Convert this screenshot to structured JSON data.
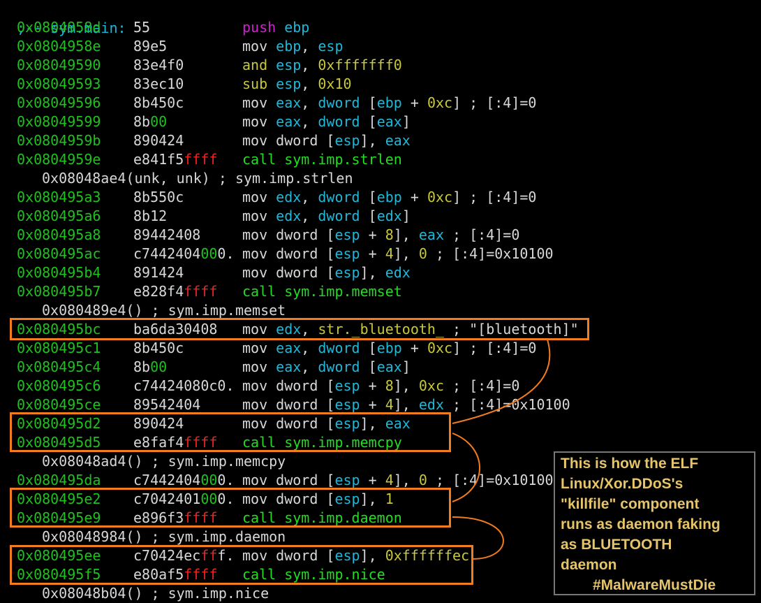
{
  "header": ";-- sym.main:",
  "colors": {
    "address": "#20c020",
    "mnemonic_default": "#d8d8d8",
    "register": "#1fb7d8",
    "immediate": "#c8c83a",
    "push": "#d020d0",
    "call": "#22dd22",
    "ff_bytes": "#ee2020",
    "highlight_box": "#f27c20",
    "note_text": "#e6c46a"
  },
  "lines": [
    {
      "addr": "0x0804958d",
      "bytes": [
        [
          "55",
          "white"
        ]
      ],
      "instr": [
        [
          "push ",
          "magenta"
        ],
        [
          "ebp",
          "cyan"
        ]
      ]
    },
    {
      "addr": "0x0804958e",
      "bytes": [
        [
          "89e5",
          "white"
        ]
      ],
      "instr": [
        [
          "mov ",
          "white"
        ],
        [
          "ebp",
          "cyan"
        ],
        [
          ", ",
          "white"
        ],
        [
          "esp",
          "cyan"
        ]
      ]
    },
    {
      "addr": "0x08049590",
      "bytes": [
        [
          "83e4f0",
          "white"
        ]
      ],
      "instr": [
        [
          "and ",
          "yellow"
        ],
        [
          "esp",
          "cyan"
        ],
        [
          ", ",
          "white"
        ],
        [
          "0xfffffff0",
          "yellow"
        ]
      ]
    },
    {
      "addr": "0x08049593",
      "bytes": [
        [
          "83ec10",
          "white"
        ]
      ],
      "instr": [
        [
          "sub ",
          "yellow"
        ],
        [
          "esp",
          "cyan"
        ],
        [
          ", ",
          "white"
        ],
        [
          "0x10",
          "yellow"
        ]
      ]
    },
    {
      "addr": "0x08049596",
      "bytes": [
        [
          "8b450c",
          "white"
        ]
      ],
      "instr": [
        [
          "mov ",
          "white"
        ],
        [
          "eax",
          "cyan"
        ],
        [
          ", ",
          "white"
        ],
        [
          "dword ",
          "cyan"
        ],
        [
          "[",
          "white"
        ],
        [
          "ebp",
          "cyan"
        ],
        [
          " + ",
          "white"
        ],
        [
          "0xc",
          "yellow"
        ],
        [
          "] ; [:4]=0",
          "white"
        ]
      ]
    },
    {
      "addr": "0x08049599",
      "bytes": [
        [
          "8b",
          "white"
        ],
        [
          "00",
          "green"
        ]
      ],
      "instr": [
        [
          "mov ",
          "white"
        ],
        [
          "eax",
          "cyan"
        ],
        [
          ", ",
          "white"
        ],
        [
          "dword ",
          "cyan"
        ],
        [
          "[",
          "white"
        ],
        [
          "eax",
          "cyan"
        ],
        [
          "]",
          "white"
        ]
      ]
    },
    {
      "addr": "0x0804959b",
      "bytes": [
        [
          "890424",
          "white"
        ]
      ],
      "instr": [
        [
          "mov dword ",
          "white"
        ],
        [
          "[",
          "white"
        ],
        [
          "esp",
          "cyan"
        ],
        [
          "], ",
          "white"
        ],
        [
          "eax",
          "cyan"
        ]
      ]
    },
    {
      "addr": "0x0804959e",
      "bytes": [
        [
          "e841f5",
          "white"
        ],
        [
          "ffff",
          "red"
        ]
      ],
      "instr": [
        [
          "call ",
          "lime"
        ],
        [
          "sym.imp.strlen",
          "lime"
        ]
      ]
    },
    {
      "sub": "0x08048ae4(unk, unk) ; sym.imp.strlen"
    },
    {
      "addr": "0x080495a3",
      "bytes": [
        [
          "8b550c",
          "white"
        ]
      ],
      "instr": [
        [
          "mov ",
          "white"
        ],
        [
          "edx",
          "cyan"
        ],
        [
          ", ",
          "white"
        ],
        [
          "dword ",
          "cyan"
        ],
        [
          "[",
          "white"
        ],
        [
          "ebp",
          "cyan"
        ],
        [
          " + ",
          "white"
        ],
        [
          "0xc",
          "yellow"
        ],
        [
          "] ; [:4]=0",
          "white"
        ]
      ]
    },
    {
      "addr": "0x080495a6",
      "bytes": [
        [
          "8b12",
          "white"
        ]
      ],
      "instr": [
        [
          "mov ",
          "white"
        ],
        [
          "edx",
          "cyan"
        ],
        [
          ", ",
          "white"
        ],
        [
          "dword ",
          "cyan"
        ],
        [
          "[",
          "white"
        ],
        [
          "edx",
          "cyan"
        ],
        [
          "]",
          "white"
        ]
      ]
    },
    {
      "addr": "0x080495a8",
      "bytes": [
        [
          "89442408",
          "white"
        ]
      ],
      "instr": [
        [
          "mov dword ",
          "white"
        ],
        [
          "[",
          "white"
        ],
        [
          "esp",
          "cyan"
        ],
        [
          " + ",
          "white"
        ],
        [
          "8",
          "yellow"
        ],
        [
          "], ",
          "white"
        ],
        [
          "eax",
          "cyan"
        ],
        [
          " ; [:4]=0",
          "white"
        ]
      ]
    },
    {
      "addr": "0x080495ac",
      "bytes": [
        [
          "c7442404",
          "white"
        ],
        [
          "00",
          "green"
        ],
        [
          "0.",
          "white"
        ]
      ],
      "instr": [
        [
          "mov dword ",
          "white"
        ],
        [
          "[",
          "white"
        ],
        [
          "esp",
          "cyan"
        ],
        [
          " + ",
          "white"
        ],
        [
          "4",
          "yellow"
        ],
        [
          "], ",
          "white"
        ],
        [
          "0",
          "yellow"
        ],
        [
          " ; [:4]=0x10100",
          "white"
        ]
      ]
    },
    {
      "addr": "0x080495b4",
      "bytes": [
        [
          "891424",
          "white"
        ]
      ],
      "instr": [
        [
          "mov dword ",
          "white"
        ],
        [
          "[",
          "white"
        ],
        [
          "esp",
          "cyan"
        ],
        [
          "], ",
          "white"
        ],
        [
          "edx",
          "cyan"
        ]
      ]
    },
    {
      "addr": "0x080495b7",
      "bytes": [
        [
          "e828f4",
          "white"
        ],
        [
          "ffff",
          "red"
        ]
      ],
      "instr": [
        [
          "call ",
          "lime"
        ],
        [
          "sym.imp.memset",
          "lime"
        ]
      ]
    },
    {
      "sub": "0x080489e4() ; sym.imp.memset"
    },
    {
      "addr": "0x080495bc",
      "bytes": [
        [
          "ba6da30408",
          "white"
        ]
      ],
      "instr": [
        [
          "mov ",
          "white"
        ],
        [
          "edx",
          "cyan"
        ],
        [
          ", ",
          "white"
        ],
        [
          "str._bluetooth_",
          "yellow"
        ],
        [
          " ; \"[bluetooth]\"",
          "white"
        ]
      ]
    },
    {
      "addr": "0x080495c1",
      "bytes": [
        [
          "8b450c",
          "white"
        ]
      ],
      "instr": [
        [
          "mov ",
          "white"
        ],
        [
          "eax",
          "cyan"
        ],
        [
          ", ",
          "white"
        ],
        [
          "dword ",
          "cyan"
        ],
        [
          "[",
          "white"
        ],
        [
          "ebp",
          "cyan"
        ],
        [
          " + ",
          "white"
        ],
        [
          "0xc",
          "yellow"
        ],
        [
          "] ; [:4]=0",
          "white"
        ]
      ]
    },
    {
      "addr": "0x080495c4",
      "bytes": [
        [
          "8b",
          "white"
        ],
        [
          "00",
          "green"
        ]
      ],
      "instr": [
        [
          "mov ",
          "white"
        ],
        [
          "eax",
          "cyan"
        ],
        [
          ", ",
          "white"
        ],
        [
          "dword ",
          "cyan"
        ],
        [
          "[",
          "white"
        ],
        [
          "eax",
          "cyan"
        ],
        [
          "]",
          "white"
        ]
      ]
    },
    {
      "addr": "0x080495c6",
      "bytes": [
        [
          "c74424080c0.",
          "white"
        ]
      ],
      "instr": [
        [
          "mov dword ",
          "white"
        ],
        [
          "[",
          "white"
        ],
        [
          "esp",
          "cyan"
        ],
        [
          " + ",
          "white"
        ],
        [
          "8",
          "yellow"
        ],
        [
          "], ",
          "white"
        ],
        [
          "0xc",
          "yellow"
        ],
        [
          " ; [:4]=0",
          "white"
        ]
      ]
    },
    {
      "addr": "0x080495ce",
      "bytes": [
        [
          "89542404",
          "white"
        ]
      ],
      "instr": [
        [
          "mov dword ",
          "white"
        ],
        [
          "[",
          "white"
        ],
        [
          "esp",
          "cyan"
        ],
        [
          " + ",
          "white"
        ],
        [
          "4",
          "yellow"
        ],
        [
          "], ",
          "white"
        ],
        [
          "edx",
          "cyan"
        ],
        [
          " ; [:4]=0x10100",
          "white"
        ]
      ]
    },
    {
      "addr": "0x080495d2",
      "bytes": [
        [
          "890424",
          "white"
        ]
      ],
      "instr": [
        [
          "mov dword ",
          "white"
        ],
        [
          "[",
          "white"
        ],
        [
          "esp",
          "cyan"
        ],
        [
          "], ",
          "white"
        ],
        [
          "eax",
          "cyan"
        ]
      ]
    },
    {
      "addr": "0x080495d5",
      "bytes": [
        [
          "e8faf4",
          "white"
        ],
        [
          "ffff",
          "red"
        ]
      ],
      "instr": [
        [
          "call ",
          "lime"
        ],
        [
          "sym.imp.memcpy",
          "lime"
        ]
      ]
    },
    {
      "sub": "0x08048ad4() ; sym.imp.memcpy"
    },
    {
      "addr": "0x080495da",
      "bytes": [
        [
          "c7442404",
          "white"
        ],
        [
          "00",
          "green"
        ],
        [
          "0.",
          "white"
        ]
      ],
      "instr": [
        [
          "mov dword ",
          "white"
        ],
        [
          "[",
          "white"
        ],
        [
          "esp",
          "cyan"
        ],
        [
          " + ",
          "white"
        ],
        [
          "4",
          "yellow"
        ],
        [
          "], ",
          "white"
        ],
        [
          "0",
          "yellow"
        ],
        [
          " ; [:4]=0x10100",
          "white"
        ]
      ]
    },
    {
      "addr": "0x080495e2",
      "bytes": [
        [
          "c7042401",
          "white"
        ],
        [
          "00",
          "green"
        ],
        [
          "0.",
          "white"
        ]
      ],
      "instr": [
        [
          "mov dword ",
          "white"
        ],
        [
          "[",
          "white"
        ],
        [
          "esp",
          "cyan"
        ],
        [
          "], ",
          "white"
        ],
        [
          "1",
          "yellow"
        ]
      ]
    },
    {
      "addr": "0x080495e9",
      "bytes": [
        [
          "e896f3",
          "white"
        ],
        [
          "ffff",
          "red"
        ]
      ],
      "instr": [
        [
          "call ",
          "lime"
        ],
        [
          "sym.imp.daemon",
          "lime"
        ]
      ]
    },
    {
      "sub": "0x08048984() ; sym.imp.daemon"
    },
    {
      "addr": "0x080495ee",
      "bytes": [
        [
          "c70424ec",
          "white"
        ],
        [
          "ff",
          "red"
        ],
        [
          "f.",
          "white"
        ]
      ],
      "instr": [
        [
          "mov dword ",
          "white"
        ],
        [
          "[",
          "white"
        ],
        [
          "esp",
          "cyan"
        ],
        [
          "], ",
          "white"
        ],
        [
          "0xffffffec",
          "yellow"
        ]
      ]
    },
    {
      "addr": "0x080495f5",
      "bytes": [
        [
          "e80af5",
          "white"
        ],
        [
          "ffff",
          "red"
        ]
      ],
      "instr": [
        [
          "call ",
          "lime"
        ],
        [
          "sym.imp.nice",
          "lime"
        ]
      ]
    },
    {
      "sub": "0x08048b04() ; sym.imp.nice"
    }
  ],
  "note": {
    "lines": [
      "This is how the ELF",
      "Linux/Xor.DDoS's",
      "\"killfile\" component",
      "runs as daemon faking",
      "as BLUETOOTH",
      "daemon"
    ],
    "tag": "#MalwareMustDie"
  }
}
